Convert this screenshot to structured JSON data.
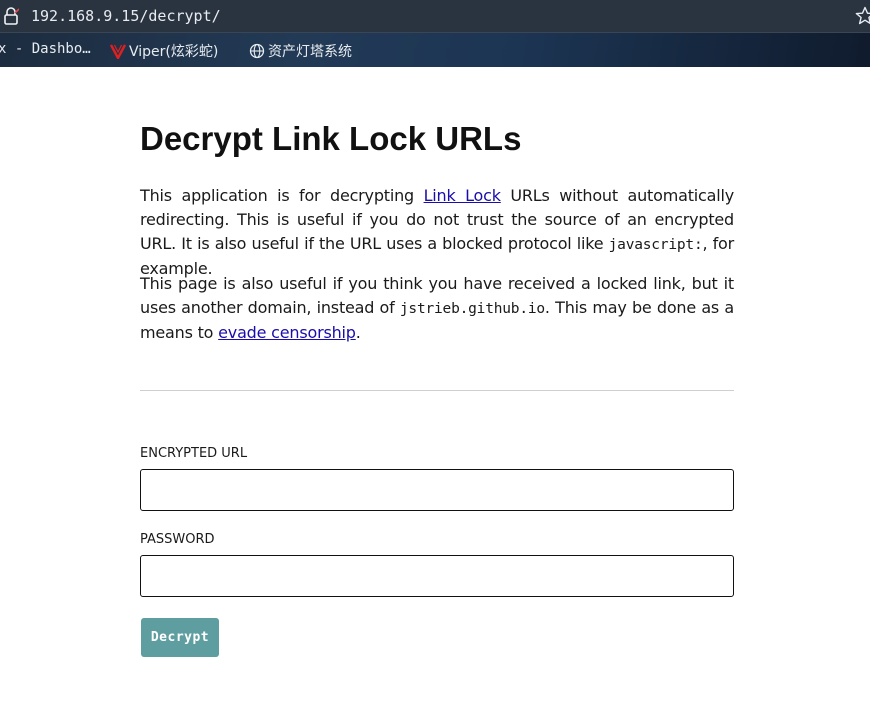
{
  "browser": {
    "url": "192.168.9.15/decrypt/",
    "bookmarks": [
      {
        "label": "x - Dashbo…",
        "icon": "none"
      },
      {
        "label": "Viper(炫彩蛇)",
        "icon": "viper-icon"
      },
      {
        "label": "资产灯塔系统",
        "icon": "globe-icon"
      }
    ]
  },
  "page": {
    "title": "Decrypt Link Lock URLs",
    "p1": {
      "before_link": "This application is for decrypting ",
      "link": "Link Lock",
      "after_link": " URLs without automatically redirecting. This is useful if you do not trust the source of an encrypted URL. It is also useful if the URL uses a blocked protocol like ",
      "code": "javascript:",
      "end": ", for example."
    },
    "p2": {
      "before_code": "This page is also useful if you think you have received a locked link, but it uses another domain, instead of ",
      "code": "jstrieb.github.io",
      "middle": ". This may be done as a means to ",
      "link": "evade censorship",
      "end": "."
    },
    "form": {
      "url_label": "ENCRYPTED URL",
      "url_value": "",
      "password_label": "PASSWORD",
      "password_value": "",
      "button_label": "Decrypt"
    }
  },
  "colors": {
    "button_bg": "#5f9ea0",
    "link": "#1a0dab"
  }
}
